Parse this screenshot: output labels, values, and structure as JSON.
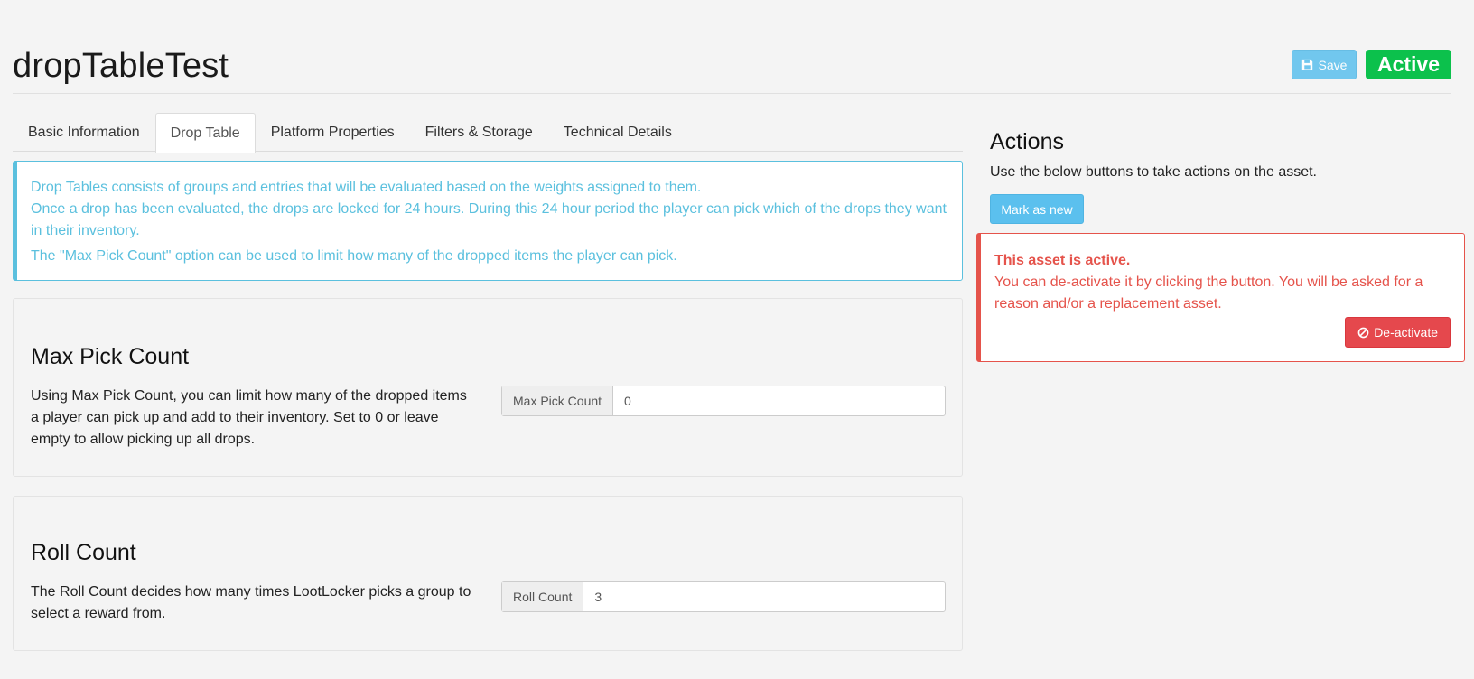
{
  "header": {
    "title": "dropTableTest",
    "save_label": "Save",
    "status_badge": "Active"
  },
  "tabs": [
    {
      "label": "Basic Information",
      "active": false
    },
    {
      "label": "Drop Table",
      "active": true
    },
    {
      "label": "Platform Properties",
      "active": false
    },
    {
      "label": "Filters & Storage",
      "active": false
    },
    {
      "label": "Technical Details",
      "active": false
    }
  ],
  "info": {
    "line1": "Drop Tables consists of groups and entries that will be evaluated based on the weights assigned to them.",
    "line2": "Once a drop has been evaluated, the drops are locked for 24 hours. During this 24 hour period the player can pick which of the drops they want in their inventory.",
    "line3": "The \"Max Pick Count\" option can be used to limit how many of the dropped items the player can pick."
  },
  "max_pick": {
    "heading": "Max Pick Count",
    "description": "Using Max Pick Count, you can limit how many of the dropped items a player can pick up and add to their inventory. Set to 0 or leave empty to allow picking up all drops.",
    "addon_label": "Max Pick Count",
    "value": "0"
  },
  "roll_count": {
    "heading": "Roll Count",
    "description": "The Roll Count decides how many times LootLocker picks a group to select a reward from.",
    "addon_label": "Roll Count",
    "value": "3"
  },
  "actions": {
    "title": "Actions",
    "description": "Use the below buttons to take actions on the asset.",
    "mark_new_label": "Mark as new",
    "warning_title": "This asset is active.",
    "warning_text": "You can de-activate it by clicking the button. You will be asked for a reason and/or a replacement asset.",
    "deactivate_label": "De-activate"
  },
  "colors": {
    "accent": "#5bc0de",
    "active_green": "#0cc14c",
    "danger": "#e5534b"
  },
  "icons": {
    "save": "floppy-disk-icon",
    "deactivate": "ban-icon"
  }
}
